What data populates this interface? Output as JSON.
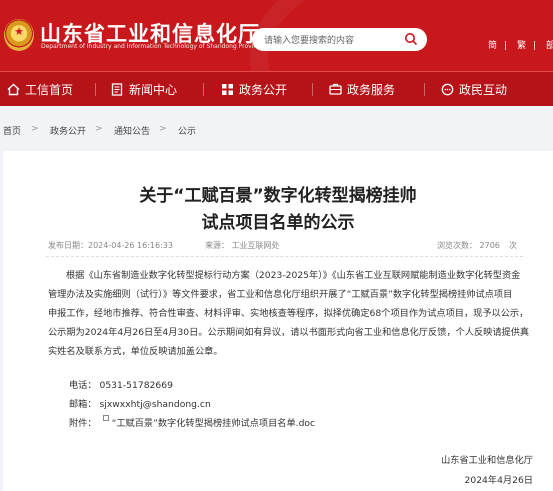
{
  "header": {
    "site_title": "山东省工业和信息化厅",
    "site_subtitle": "Department of Industry and Information Technology of Shandong Province",
    "search_placeholder": "请输入您要搜索的内容",
    "links": [
      "简",
      "繁",
      "部属"
    ]
  },
  "nav": {
    "items": [
      {
        "label": "工信首页",
        "icon": "home-icon"
      },
      {
        "label": "新闻中心",
        "icon": "document-icon"
      },
      {
        "label": "政务公开",
        "icon": "grid-icon"
      },
      {
        "label": "政务服务",
        "icon": "service-icon"
      },
      {
        "label": "政民互动",
        "icon": "chat-icon"
      }
    ]
  },
  "breadcrumb": {
    "items": [
      "首页",
      "政务公开",
      "通知公告",
      "公示"
    ],
    "separator": ">"
  },
  "article": {
    "title_line1": "关于“工赋百景”数字化转型揭榜挂帅",
    "title_line2": "试点项目名单的公示",
    "published": "发布日期：2024-04-26 16:16:33",
    "source": "来源： 工业互联网处",
    "views": "浏览次数： 2706",
    "views_suffix": "次",
    "paragraph_lines": [
      "根据《山东省制造业数字化转型提标行动方案（2023-2025年）》《山东省工业互联网赋能制造业数字化转型资金",
      "管理办法及实施细则（试行）》等文件要求，省工业和信息化厅组织开展了“工赋百景”数字化转型揭榜挂帅试点项目",
      "申报工作，经地市推荐、符合性审查、材料评审、实地核查等程序，拟择优确定68个项目作为试点项目，现予以公示，",
      "公示期为2024年4月26日至4月30日。公示期间如有异议，请以书面形式向省工业和信息化厅反馈，个人反映请提供真",
      "实姓名及联系方式，单位反映请加盖公章。"
    ],
    "phone": "电话：  0531-51782669",
    "email": "邮箱：  sjxwxxhtj@shandong.cn",
    "attachment_label": "附件：",
    "attachment_name": "“工赋百景”数字化转型揭榜挂帅试点项目名单.doc",
    "signature_org": "山东省工业和信息化厅",
    "signature_date": "2024年4月26日"
  },
  "colors": {
    "brand_red": "#c8181c",
    "nav_red": "#b51318",
    "page_bg": "#f1f3f6"
  }
}
